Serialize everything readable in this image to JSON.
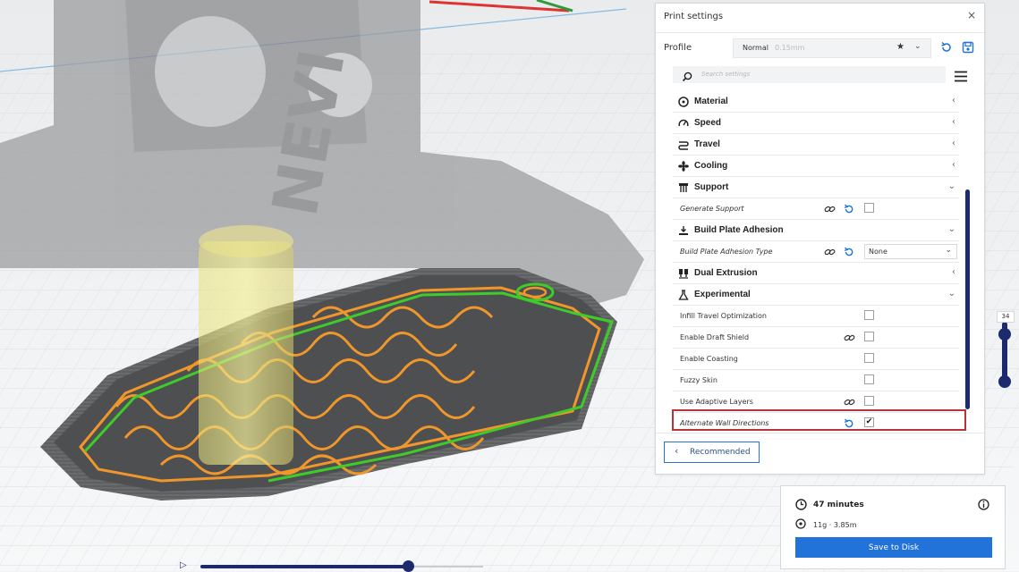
{
  "print_settings": {
    "title": "Print settings",
    "close_glyph": "×",
    "profile_label": "Profile",
    "profile_name": "Normal",
    "profile_layer": "0.15mm",
    "search_placeholder": "Search settings",
    "categories": {
      "material": "Material",
      "speed": "Speed",
      "travel": "Travel",
      "cooling": "Cooling",
      "support": "Support",
      "adhesion": "Build Plate Adhesion",
      "dual": "Dual Extrusion",
      "experimental": "Experimental"
    },
    "settings": {
      "generate_support": "Generate Support",
      "adhesion_type": "Build Plate Adhesion Type",
      "adhesion_value": "None",
      "infill_travel": "Infill Travel Optimization",
      "draft_shield": "Enable Draft Shield",
      "coasting": "Enable Coasting",
      "fuzzy_skin": "Fuzzy Skin",
      "adaptive_layers": "Use Adaptive Layers",
      "alternate_wall": "Alternate Wall Directions",
      "alternate_wall_checked": "✔"
    },
    "recommended_label": "Recommended"
  },
  "estimate": {
    "time": "47 minutes",
    "material": "11g · 3.85m",
    "save_label": "Save to Disk"
  },
  "layer_slider": {
    "value": "34"
  },
  "colors": {
    "accent_blue": "#2172d9",
    "dark_navy": "#1e2a6e",
    "wall_orange": "#f0962a",
    "wall_green": "#3fcb2a",
    "highlight_red": "#b7333a"
  }
}
